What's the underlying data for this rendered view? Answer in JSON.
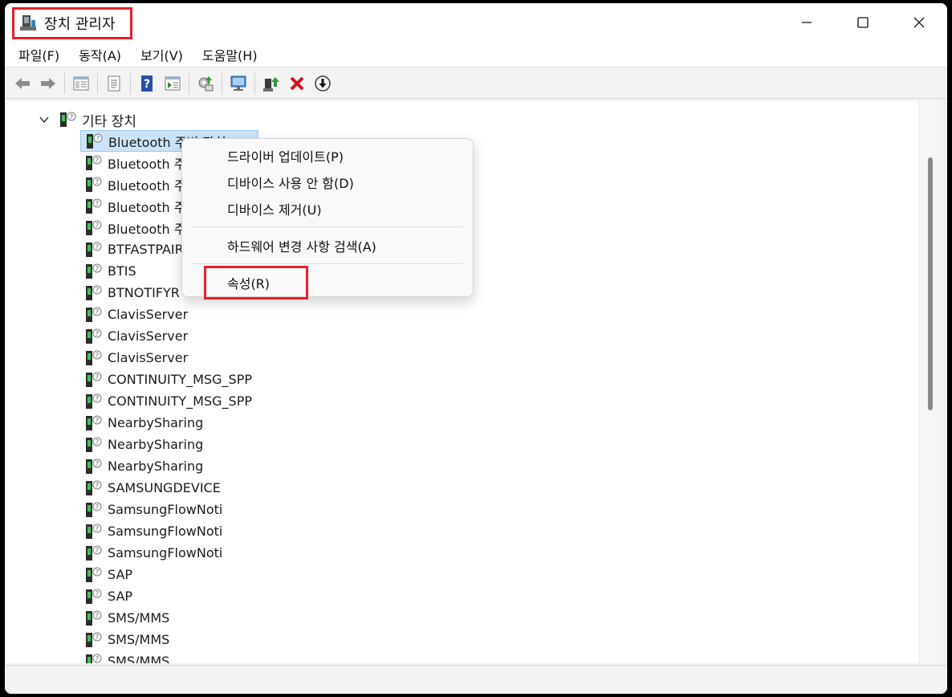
{
  "window": {
    "title": "장치 관리자"
  },
  "menubar": {
    "items": [
      "파일(F)",
      "동작(A)",
      "보기(V)",
      "도움말(H)"
    ]
  },
  "toolbar": {
    "buttons": [
      "back-icon",
      "forward-icon",
      "show-hide-console-tree-icon",
      "properties-icon",
      "help-icon",
      "view-icon",
      "scan-hardware-icon",
      "monitor-icon",
      "update-driver-icon",
      "uninstall-icon",
      "disable-icon"
    ]
  },
  "tree": {
    "category": "기타 장치",
    "items": [
      "Bluetooth 주변 장치",
      "Bluetooth 주변 장치",
      "Bluetooth 주변 장치",
      "Bluetooth 주변 장치",
      "Bluetooth 주변 장치",
      "BTFASTPAIR",
      "BTIS",
      "BTNOTIFYR",
      "ClavisServer",
      "ClavisServer",
      "ClavisServer",
      "CONTINUITY_MSG_SPP",
      "CONTINUITY_MSG_SPP",
      "NearbySharing",
      "NearbySharing",
      "NearbySharing",
      "SAMSUNGDEVICE",
      "SamsungFlowNoti",
      "SamsungFlowNoti",
      "SamsungFlowNoti",
      "SAP",
      "SAP",
      "SMS/MMS",
      "SMS/MMS",
      "SMS/MMS"
    ]
  },
  "context_menu": {
    "update_driver": "드라이버 업데이트(P)",
    "disable_device": "디바이스 사용 안 함(D)",
    "uninstall_device": "디바이스 제거(U)",
    "scan_hardware": "하드웨어 변경 사항 검색(A)",
    "properties": "속성(R)"
  },
  "colors": {
    "highlight_border": "#e8202a",
    "selection": "#cce4f7"
  }
}
